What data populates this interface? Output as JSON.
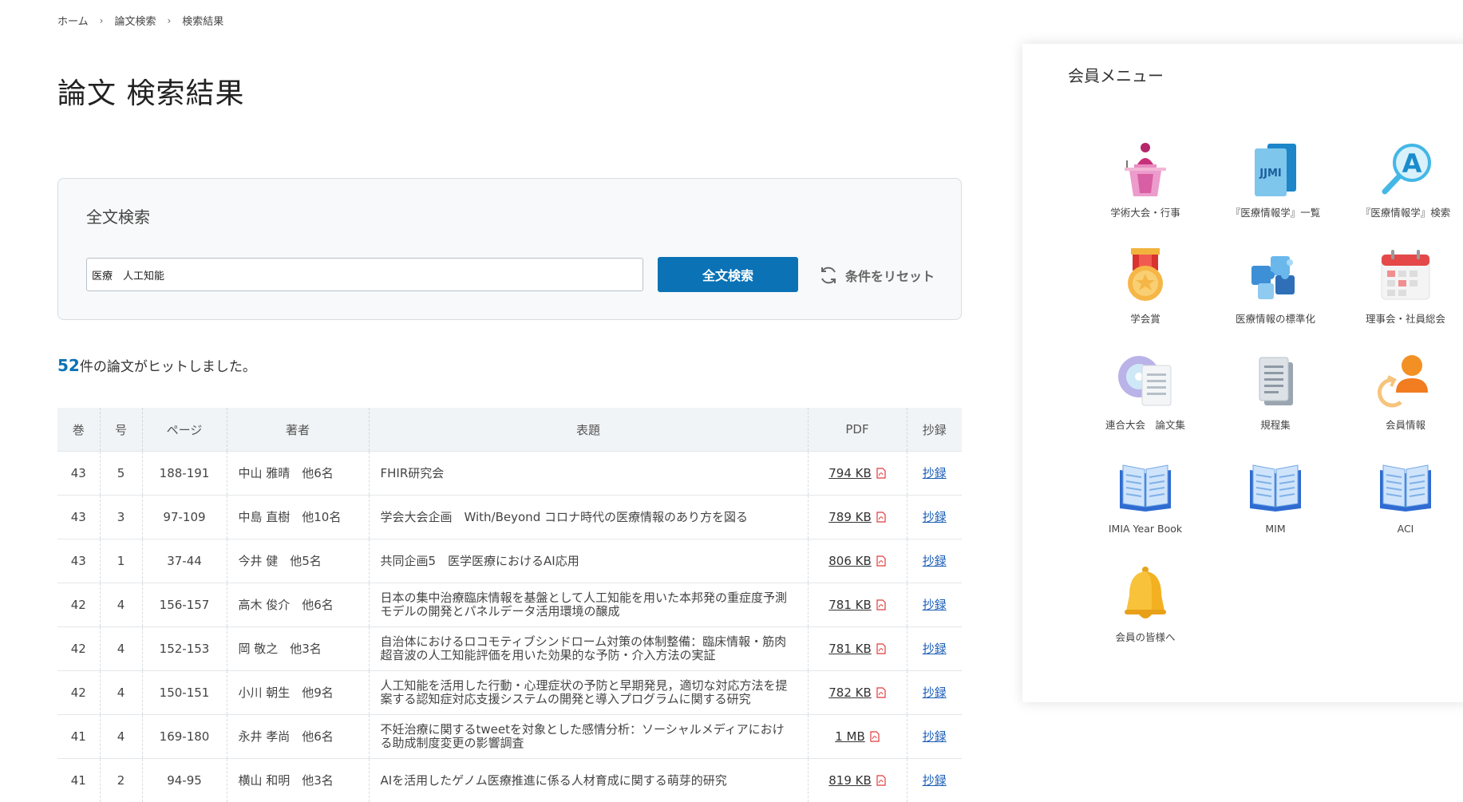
{
  "breadcrumb": {
    "home": "ホーム",
    "section": "論文検索",
    "current": "検索結果"
  },
  "page_title": "論文 検索結果",
  "search": {
    "title": "全文検索",
    "value": "医療　人工知能",
    "button_label": "全文検索",
    "reset_label": "条件をリセット"
  },
  "hits": {
    "count": "52",
    "text": "件の論文がヒットしました。"
  },
  "table": {
    "headers": {
      "volume": "巻",
      "issue": "号",
      "pages": "ページ",
      "author": "著者",
      "title": "表題",
      "pdf": "PDF",
      "abstract": "抄録"
    },
    "rows": [
      {
        "volume": "43",
        "issue": "5",
        "pages": "188-191",
        "author": "中山 雅晴　他6名",
        "title": "FHIR研究会",
        "pdf": "794 KB",
        "abstract": "抄録"
      },
      {
        "volume": "43",
        "issue": "3",
        "pages": "97-109",
        "author": "中島 直樹　他10名",
        "title": "学会大会企画　With/Beyond コロナ時代の医療情報のあり方を図る",
        "pdf": "789 KB",
        "abstract": "抄録"
      },
      {
        "volume": "43",
        "issue": "1",
        "pages": "37-44",
        "author": "今井 健　他5名",
        "title": "共同企画5　医学医療におけるAI応用",
        "pdf": "806 KB",
        "abstract": "抄録"
      },
      {
        "volume": "42",
        "issue": "4",
        "pages": "156-157",
        "author": "高木 俊介　他6名",
        "title": "日本の集中治療臨床情報を基盤として人工知能を用いた本邦発の重症度予測モデルの開発とパネルデータ活用環境の醸成",
        "pdf": "781 KB",
        "abstract": "抄録"
      },
      {
        "volume": "42",
        "issue": "4",
        "pages": "152-153",
        "author": "岡 敬之　他3名",
        "title": "自治体におけるロコモティブシンドローム対策の体制整備：臨床情報・筋肉超音波の人工知能評価を用いた効果的な予防・介入方法の実証",
        "pdf": "781 KB",
        "abstract": "抄録"
      },
      {
        "volume": "42",
        "issue": "4",
        "pages": "150-151",
        "author": "小川 朝生　他9名",
        "title": "人工知能を活用した行動・心理症状の予防と早期発見，適切な対応方法を提案する認知症対応支援システムの開発と導入プログラムに関する研究",
        "pdf": "782 KB",
        "abstract": "抄録"
      },
      {
        "volume": "41",
        "issue": "4",
        "pages": "169-180",
        "author": "永井 孝尚　他6名",
        "title": "不妊治療に関するtweetを対象とした感情分析：ソーシャルメディアにおける助成制度変更の影響調査",
        "pdf": "1 MB",
        "abstract": "抄録"
      },
      {
        "volume": "41",
        "issue": "2",
        "pages": "94-95",
        "author": "横山 和明　他3名",
        "title": "AIを活用したゲノム医療推進に係る人材育成に関する萌芽的研究",
        "pdf": "819 KB",
        "abstract": "抄録"
      }
    ]
  },
  "member_menu": {
    "title": "会員メニュー",
    "items": [
      {
        "label": "学術大会・行事",
        "icon": "podium-icon"
      },
      {
        "label": "『医療情報学』一覧",
        "icon": "jjmi-journal-icon"
      },
      {
        "label": "『医療情報学』検索",
        "icon": "search-a-icon"
      },
      {
        "label": "学会賞",
        "icon": "medal-icon"
      },
      {
        "label": "医療情報の標準化",
        "icon": "puzzle-icon"
      },
      {
        "label": "理事会・社員総会",
        "icon": "calendar-icon"
      },
      {
        "label": "連合大会　論文集",
        "icon": "cd-document-icon"
      },
      {
        "label": "規程集",
        "icon": "document-stack-icon"
      },
      {
        "label": "会員情報",
        "icon": "user-refresh-icon"
      },
      {
        "label": "IMIA Year Book",
        "icon": "open-book-icon"
      },
      {
        "label": "MIM",
        "icon": "open-book-icon"
      },
      {
        "label": "ACI",
        "icon": "open-book-icon"
      },
      {
        "label": "会員の皆様へ",
        "icon": "bell-icon"
      }
    ],
    "jjmi_text": "JJMI",
    "search_letter": "A"
  },
  "colors": {
    "accent": "#0a72b5",
    "link": "#1a5db5",
    "pdf_icon": "#e23b3b"
  }
}
